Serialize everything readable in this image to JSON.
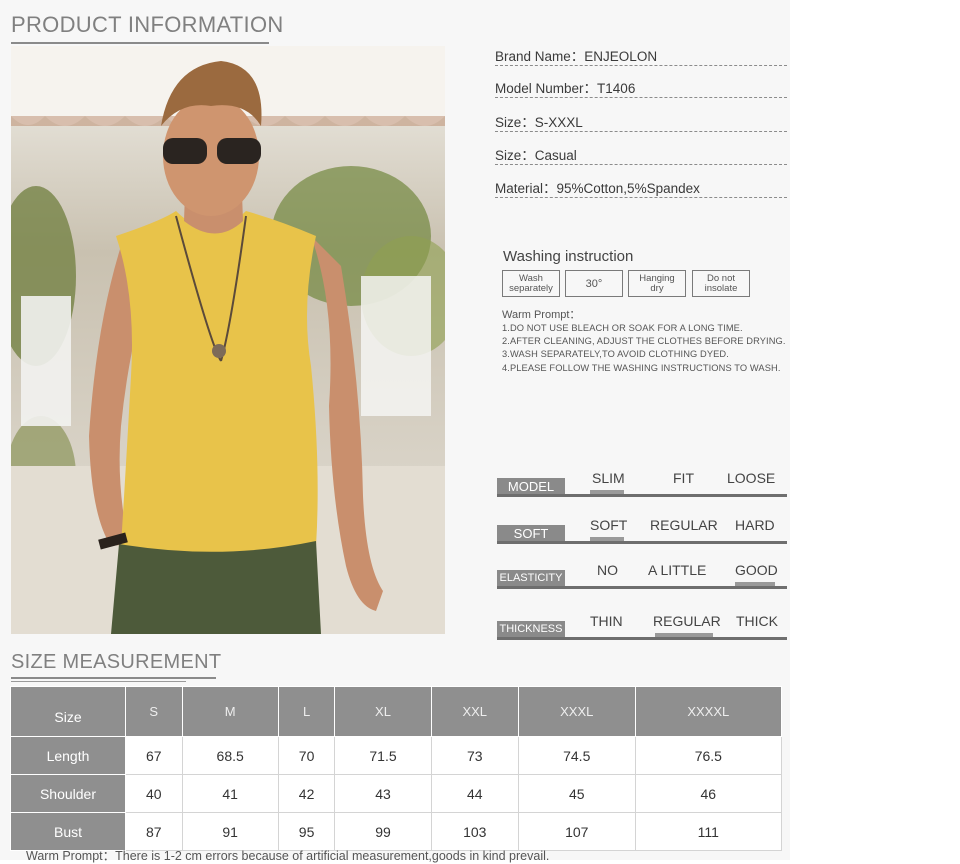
{
  "sections": {
    "product_info_title": "PRODUCT INFORMATION",
    "size_title": "SIZE MEASUREMENT"
  },
  "specs": [
    {
      "label": "Brand Name：",
      "value": "ENJEOLON"
    },
    {
      "label": "Model Number：",
      "value": "T1406"
    },
    {
      "label": "Size：",
      "value": "S-XXXL"
    },
    {
      "label": "Size：",
      "value": "Casual"
    },
    {
      "label": "Material：",
      "value": "95%Cotton,5%Spandex"
    }
  ],
  "washing": {
    "title": "Washing instruction",
    "boxes": [
      {
        "line1": "Wash",
        "line2": "separately"
      },
      {
        "line1": "30°",
        "line2": ""
      },
      {
        "line1": "Hanging",
        "line2": "dry"
      },
      {
        "line1": "Do not",
        "line2": "insolate"
      }
    ],
    "warm_title": "Warm Prompt：",
    "warm_lines": [
      "1.DO NOT USE BLEACH OR SOAK FOR A LONG TIME.",
      "2.AFTER CLEANING, ADJUST THE CLOTHES BEFORE DRYING.",
      "3.WASH SEPARATELY,TO AVOID CLOTHING DYED.",
      "4.PLEASE FOLLOW THE WASHING INSTRUCTIONS TO WASH."
    ]
  },
  "ratings": [
    {
      "label": "MODEL",
      "options": [
        "SLIM",
        "FIT",
        "LOOSE"
      ],
      "selected": "SLIM"
    },
    {
      "label": "SOFT",
      "options": [
        "SOFT",
        "REGULAR",
        "HARD"
      ],
      "selected": "SOFT"
    },
    {
      "label": "ELASTICITY",
      "options": [
        "NO",
        "A LITTLE",
        "GOOD"
      ],
      "selected": "GOOD"
    },
    {
      "label": "THICKNESS",
      "options": [
        "THIN",
        "REGULAR",
        "THICK"
      ],
      "selected": "REGULAR"
    }
  ],
  "size_table": {
    "corner": "Size",
    "sizes": [
      "S",
      "M",
      "L",
      "XL",
      "XXL",
      "XXXL",
      "XXXXL"
    ],
    "rows": [
      {
        "name": "Length",
        "values": [
          "67",
          "68.5",
          "70",
          "71.5",
          "73",
          "74.5",
          "76.5"
        ]
      },
      {
        "name": "Shoulder",
        "values": [
          "40",
          "41",
          "42",
          "43",
          "44",
          "45",
          "46"
        ]
      },
      {
        "name": "Bust",
        "values": [
          "87",
          "91",
          "95",
          "99",
          "103",
          "107",
          "111"
        ]
      }
    ]
  },
  "footer_note": "Warm Prompt：There is 1-2 cm errors because of artificial measurement,goods in kind prevail.",
  "colors": {
    "panel_bg": "#f7f7f7",
    "table_header": "#8f8f8f",
    "shirt": "#e8c34a",
    "pants": "#4d5a3a"
  }
}
